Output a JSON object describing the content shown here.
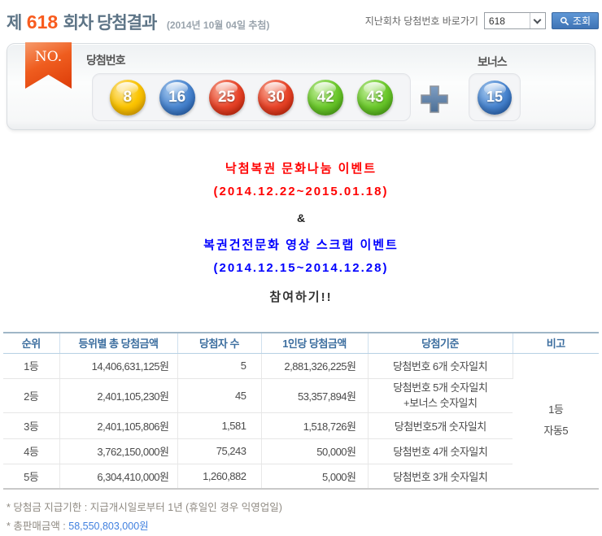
{
  "header": {
    "round_prefix": "제",
    "round_number": "618",
    "round_suffix": "회차 당첨결과",
    "draw_date": "(2014년 10월 04일 추첨)",
    "quick_link_label": "지난회차 당첨번호 바로가기",
    "round_select_value": "618",
    "search_button_label": "조회"
  },
  "winning_panel": {
    "ribbon_label": "NO.",
    "numbers_label": "당첨번호",
    "bonus_label": "보너스",
    "balls": [
      {
        "number": "8",
        "color": "yellow"
      },
      {
        "number": "16",
        "color": "blue"
      },
      {
        "number": "25",
        "color": "red"
      },
      {
        "number": "30",
        "color": "red"
      },
      {
        "number": "42",
        "color": "green"
      },
      {
        "number": "43",
        "color": "green"
      }
    ],
    "bonus_ball": {
      "number": "15",
      "color": "blue"
    }
  },
  "events": {
    "event1_title": "낙첨복권 문화나눔 이벤트",
    "event1_period": "(2014.12.22~2015.01.18)",
    "ampersand": "&",
    "event2_title": "복권건전문화 영상 스크랩 이벤트",
    "event2_period": "(2014.12.15~2014.12.28)",
    "join_label": "참여하기!!"
  },
  "result_table": {
    "headers": [
      "순위",
      "등위별 총 당첨금액",
      "당첨자 수",
      "1인당 당첨금액",
      "당첨기준",
      "비고"
    ],
    "rows": [
      {
        "rank": "1등",
        "total_prize": "14,406,631,125원",
        "winners": "5",
        "prize_per_winner": "2,881,326,225원",
        "criteria": "당첨번호 6개 숫자일치"
      },
      {
        "rank": "2등",
        "total_prize": "2,401,105,230원",
        "winners": "45",
        "prize_per_winner": "53,357,894원",
        "criteria": "당첨번호 5개 숫자일치",
        "criteria2": "+보너스 숫자일치"
      },
      {
        "rank": "3등",
        "total_prize": "2,401,105,806원",
        "winners": "1,581",
        "prize_per_winner": "1,518,726원",
        "criteria": "당첨번호5개 숫자일치"
      },
      {
        "rank": "4등",
        "total_prize": "3,762,150,000원",
        "winners": "75,243",
        "prize_per_winner": "50,000원",
        "criteria": "당첨번호 4개 숫자일치"
      },
      {
        "rank": "5등",
        "total_prize": "6,304,410,000원",
        "winners": "1,260,882",
        "prize_per_winner": "5,000원",
        "criteria": "당첨번호 3개 숫자일치"
      }
    ],
    "note_line1": "1등",
    "note_line2": "자동5"
  },
  "footnotes": {
    "payment_deadline": "* 당첨금 지급기한 : 지급개시일로부터 1년 (휴일인 경우 익영업일)",
    "total_sales_label": "* 총판매금액 : ",
    "total_sales_value": "58,550,803,000원"
  },
  "colors": {
    "accent_orange": "#f85c1f",
    "title_gray_blue": "#5d7486",
    "event_red": "#ff0000",
    "event_blue": "#0000ff",
    "table_header_blue": "#3c6e9f",
    "sales_value_blue": "#4080df",
    "search_button_blue": "#4a83c9",
    "ball_yellow": "#fbc400",
    "ball_blue": "#3b78c8",
    "ball_red": "#dd3414",
    "ball_green": "#5fbe22"
  }
}
